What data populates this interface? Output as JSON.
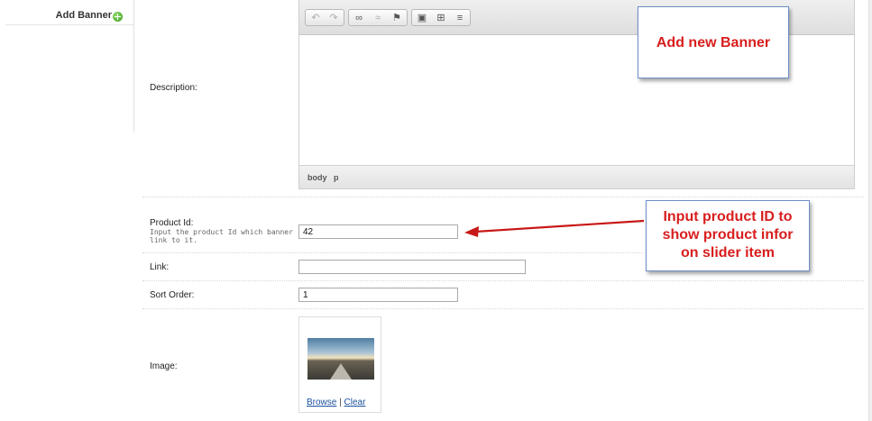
{
  "sidebar": {
    "add_banner_label": "Add Banner"
  },
  "form": {
    "description_label": "Description:",
    "product_id_label": "Product Id:",
    "product_id_hint": "Input the product Id which banner link to it.",
    "product_id_value": "42",
    "link_label": "Link:",
    "link_value": "",
    "sort_order_label": "Sort Order:",
    "sort_order_value": "1",
    "image_label": "Image:",
    "browse_label": "Browse",
    "link_separator": "|",
    "clear_label": "Clear"
  },
  "editor": {
    "statusbar_path": [
      "body",
      "p"
    ],
    "toolbar_row2": [
      {
        "icon": "undo-icon",
        "glyph": "↶"
      },
      {
        "icon": "redo-icon",
        "glyph": "↷"
      },
      {
        "icon": "link-icon",
        "glyph": "∞"
      },
      {
        "icon": "unlink-icon",
        "glyph": "≈"
      },
      {
        "icon": "anchor-flag-icon",
        "glyph": "⚑"
      },
      {
        "icon": "image-icon",
        "glyph": "▣"
      },
      {
        "icon": "table-icon",
        "glyph": "⊞"
      },
      {
        "icon": "horizontal-rule-icon",
        "glyph": "≡"
      }
    ]
  },
  "callouts": {
    "add_new_banner": "Add new Banner",
    "product_id_note": [
      "Input product ID to",
      "show product infor",
      "on slider item"
    ]
  },
  "colors": {
    "callout_text": "#d81e1e",
    "callout_border": "#6b8fc6",
    "arrow": "#c81818",
    "link": "#1a4f9c"
  }
}
